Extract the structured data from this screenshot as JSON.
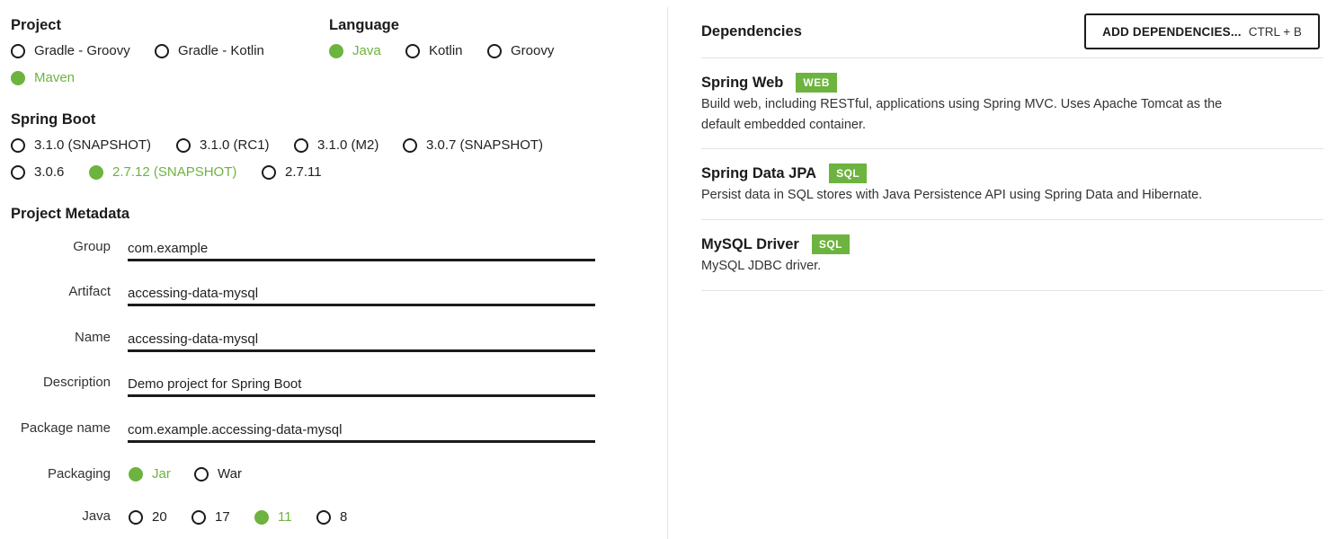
{
  "project": {
    "title": "Project",
    "options": [
      {
        "label": "Gradle - Groovy",
        "checked": false
      },
      {
        "label": "Gradle - Kotlin",
        "checked": false
      },
      {
        "label": "Maven",
        "checked": true
      }
    ]
  },
  "language": {
    "title": "Language",
    "options": [
      {
        "label": "Java",
        "checked": true
      },
      {
        "label": "Kotlin",
        "checked": false
      },
      {
        "label": "Groovy",
        "checked": false
      }
    ]
  },
  "spring_boot": {
    "title": "Spring Boot",
    "options": [
      {
        "label": "3.1.0 (SNAPSHOT)",
        "checked": false
      },
      {
        "label": "3.1.0 (RC1)",
        "checked": false
      },
      {
        "label": "3.1.0 (M2)",
        "checked": false
      },
      {
        "label": "3.0.7 (SNAPSHOT)",
        "checked": false
      },
      {
        "label": "3.0.6",
        "checked": false
      },
      {
        "label": "2.7.12 (SNAPSHOT)",
        "checked": true
      },
      {
        "label": "2.7.11",
        "checked": false
      }
    ]
  },
  "metadata": {
    "title": "Project Metadata",
    "fields": [
      {
        "label": "Group",
        "value": "com.example"
      },
      {
        "label": "Artifact",
        "value": "accessing-data-mysql"
      },
      {
        "label": "Name",
        "value": "accessing-data-mysql"
      },
      {
        "label": "Description",
        "value": "Demo project for Spring Boot"
      },
      {
        "label": "Package name",
        "value": "com.example.accessing-data-mysql"
      }
    ],
    "packaging": {
      "label": "Packaging",
      "options": [
        {
          "label": "Jar",
          "checked": true
        },
        {
          "label": "War",
          "checked": false
        }
      ]
    },
    "java": {
      "label": "Java",
      "options": [
        {
          "label": "20",
          "checked": false
        },
        {
          "label": "17",
          "checked": false
        },
        {
          "label": "11",
          "checked": true
        },
        {
          "label": "8",
          "checked": false
        }
      ]
    }
  },
  "dependencies": {
    "title": "Dependencies",
    "add_button": {
      "label": "ADD DEPENDENCIES...",
      "shortcut": "CTRL + B"
    },
    "items": [
      {
        "name": "Spring Web",
        "badge": "WEB",
        "description": "Build web, including RESTful, applications using Spring MVC. Uses Apache Tomcat as the default embedded container."
      },
      {
        "name": "Spring Data JPA",
        "badge": "SQL",
        "description": "Persist data in SQL stores with Java Persistence API using Spring Data and Hibernate."
      },
      {
        "name": "MySQL Driver",
        "badge": "SQL",
        "description": "MySQL JDBC driver."
      }
    ]
  },
  "colors": {
    "accent": "#6db33f",
    "text": "#1b1b1b",
    "divider": "#e2e2e2"
  }
}
